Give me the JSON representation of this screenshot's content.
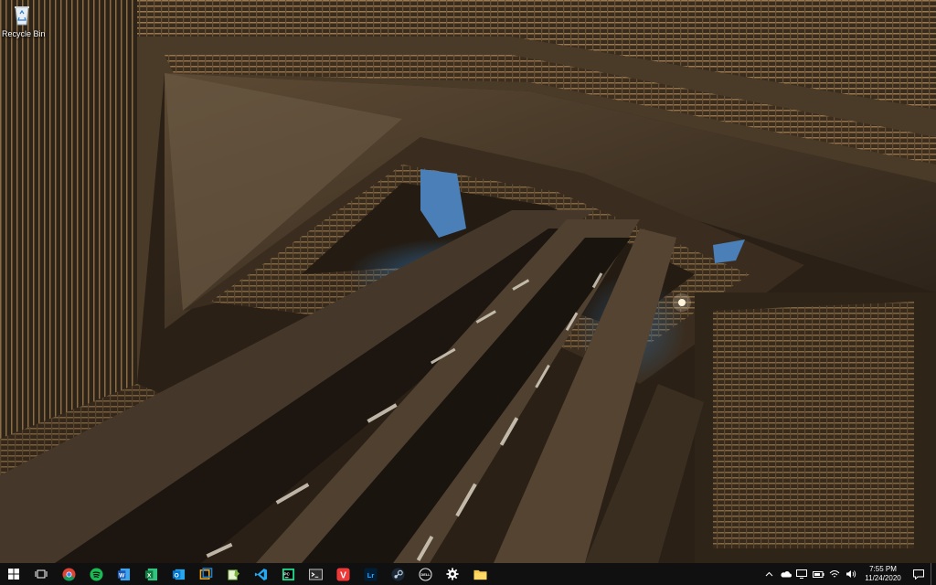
{
  "desktop": {
    "wallpaper": "atrium-looking-up-photo",
    "icons": [
      {
        "label": "Recycle Bin",
        "icon": "recycle-bin-icon"
      }
    ]
  },
  "taskbar": {
    "start": {
      "icon": "windows-start-icon"
    },
    "task_view": {
      "icon": "task-view-icon"
    },
    "apps": [
      {
        "name": "chrome",
        "icon": "chrome-icon",
        "color": "#4285f4"
      },
      {
        "name": "spotify",
        "icon": "spotify-icon",
        "color": "#1db954"
      },
      {
        "name": "word",
        "icon": "word-icon",
        "color": "#2b579a",
        "glyph": "W"
      },
      {
        "name": "excel",
        "icon": "excel-icon",
        "color": "#217346",
        "glyph": "X"
      },
      {
        "name": "outlook",
        "icon": "outlook-icon",
        "color": "#0078d4",
        "glyph": "O"
      },
      {
        "name": "virtualbox",
        "icon": "cube-app-icon",
        "color": "#f3a71a"
      },
      {
        "name": "notepad-plus",
        "icon": "notepad-plus-icon",
        "color": "#7cb342"
      },
      {
        "name": "vscode",
        "icon": "vscode-icon",
        "color": "#23a9f2"
      },
      {
        "name": "pycharm",
        "icon": "pycharm-icon",
        "color": "#21d789"
      },
      {
        "name": "terminal",
        "icon": "terminal-icon",
        "color": "#cccccc"
      },
      {
        "name": "vivaldi",
        "icon": "vivaldi-icon",
        "color": "#ef3939",
        "glyph": "V"
      },
      {
        "name": "lightroom",
        "icon": "lightroom-icon",
        "color": "#31a8ff",
        "glyph": "Lr"
      },
      {
        "name": "steam",
        "icon": "steam-icon",
        "color": "#c7d5e0"
      },
      {
        "name": "dell",
        "icon": "dell-icon",
        "color": "#ffffff",
        "glyph": "DELL"
      },
      {
        "name": "settings",
        "icon": "gear-icon",
        "color": "#ffffff"
      },
      {
        "name": "file-explorer",
        "icon": "folder-icon",
        "color": "#f8c94b"
      }
    ],
    "tray": {
      "icons": [
        "chevron-up-icon",
        "onedrive-cloud-icon",
        "monitor-icon",
        "battery-icon",
        "wifi-icon",
        "volume-icon"
      ],
      "time": "7:55 PM",
      "date": "11/24/2020",
      "notification_icon": "notification-icon"
    }
  }
}
